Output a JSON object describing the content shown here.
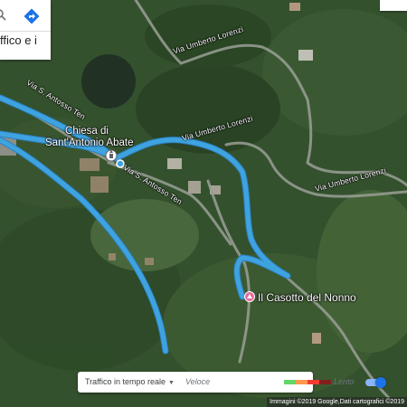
{
  "search_card": {
    "partial_text": "ffico e i",
    "zoom_icon": "magnifier-icon",
    "directions_icon": "directions-icon"
  },
  "roads": {
    "umberto_lorenzi_1": "Via Umberto Lorenzi",
    "umberto_lorenzi_2": "Via Umberto Lorenzi",
    "umberto_lorenzi_3": "Via Umberto Lorenzi",
    "sant_alfosso_1": "Via S. Antosso Ten",
    "sant_alfosso_2": "Via S. Antosso Ten"
  },
  "pois": {
    "church_line1": "Chiesa di",
    "church_line2": "Sant'Antonio Abate",
    "destination": "Il Casotto del Nonno"
  },
  "legend": {
    "traffic_label": "Traffico in tempo reale",
    "fast_label": "Veloce",
    "slow_label": "Lento",
    "scale_colors": [
      "#63d668",
      "#ff974d",
      "#f23c32",
      "#811f1f"
    ],
    "toggle_on": true
  },
  "attribution": "Immagini ©2019 Google,Dati cartografici ©2019",
  "colors": {
    "route": "#3fa3e0",
    "route_dark": "#2a82c4",
    "toggle_track": "#8ab4f8",
    "toggle_knob": "#1a73e8",
    "destination_pin": "#e8699c"
  }
}
